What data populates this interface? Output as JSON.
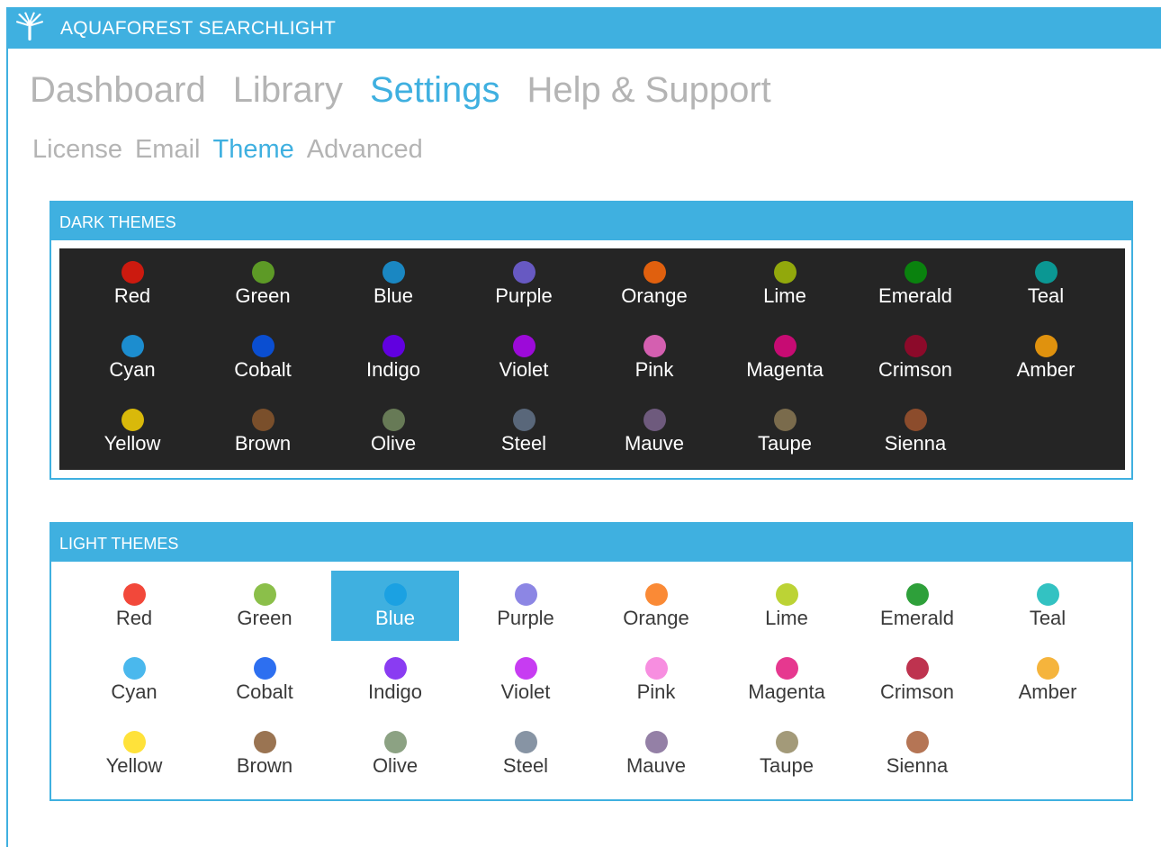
{
  "window": {
    "title": "AQUAFOREST SEARCHLIGHT",
    "icon": "aquaforest-logo-icon"
  },
  "main_nav": [
    {
      "label": "Dashboard",
      "active": false
    },
    {
      "label": "Library",
      "active": false
    },
    {
      "label": "Settings",
      "active": true
    },
    {
      "label": "Help & Support",
      "active": false
    }
  ],
  "sub_nav": [
    {
      "label": "License",
      "active": false
    },
    {
      "label": "Email",
      "active": false
    },
    {
      "label": "Theme",
      "active": true
    },
    {
      "label": "Advanced",
      "active": false
    }
  ],
  "colors": {
    "accent": "#3fb0e0",
    "dark_background": "#252525",
    "inactive_text": "#b4b4b4"
  },
  "dark_themes": {
    "header": "DARK THEMES",
    "items": [
      {
        "name": "Red",
        "color": "#cc1a0f"
      },
      {
        "name": "Green",
        "color": "#5d9a26"
      },
      {
        "name": "Blue",
        "color": "#1a87c2"
      },
      {
        "name": "Purple",
        "color": "#6759c2"
      },
      {
        "name": "Orange",
        "color": "#e0600e"
      },
      {
        "name": "Lime",
        "color": "#92a80c"
      },
      {
        "name": "Emerald",
        "color": "#0a820e"
      },
      {
        "name": "Teal",
        "color": "#0b9793"
      },
      {
        "name": "Cyan",
        "color": "#1c8dcf"
      },
      {
        "name": "Cobalt",
        "color": "#0a4ed1"
      },
      {
        "name": "Indigo",
        "color": "#6100e0"
      },
      {
        "name": "Violet",
        "color": "#9c0ad9"
      },
      {
        "name": "Pink",
        "color": "#d45fb0"
      },
      {
        "name": "Magenta",
        "color": "#c70b73"
      },
      {
        "name": "Crimson",
        "color": "#8c0a2a"
      },
      {
        "name": "Amber",
        "color": "#e0920e"
      },
      {
        "name": "Yellow",
        "color": "#d9b90a"
      },
      {
        "name": "Brown",
        "color": "#7a4f2b"
      },
      {
        "name": "Olive",
        "color": "#677a56"
      },
      {
        "name": "Steel",
        "color": "#59677a"
      },
      {
        "name": "Mauve",
        "color": "#6e5a7d"
      },
      {
        "name": "Taupe",
        "color": "#7a6b4c"
      },
      {
        "name": "Sienna",
        "color": "#8c4c2c"
      }
    ]
  },
  "light_themes": {
    "header": "LIGHT THEMES",
    "selected": "Blue",
    "items": [
      {
        "name": "Red",
        "color": "#f2483a"
      },
      {
        "name": "Green",
        "color": "#8bbf4a"
      },
      {
        "name": "Blue",
        "color": "#1ba1e2"
      },
      {
        "name": "Purple",
        "color": "#8c86e4"
      },
      {
        "name": "Orange",
        "color": "#fa8a36"
      },
      {
        "name": "Lime",
        "color": "#bcd335"
      },
      {
        "name": "Emerald",
        "color": "#2ea03a"
      },
      {
        "name": "Teal",
        "color": "#33c2c2"
      },
      {
        "name": "Cyan",
        "color": "#4ab8ed"
      },
      {
        "name": "Cobalt",
        "color": "#2d6ff0"
      },
      {
        "name": "Indigo",
        "color": "#8a3cf2"
      },
      {
        "name": "Violet",
        "color": "#c73cf2"
      },
      {
        "name": "Pink",
        "color": "#f78ee0"
      },
      {
        "name": "Magenta",
        "color": "#e6388f"
      },
      {
        "name": "Crimson",
        "color": "#be334f"
      },
      {
        "name": "Amber",
        "color": "#f5b43c"
      },
      {
        "name": "Yellow",
        "color": "#ffe23a"
      },
      {
        "name": "Brown",
        "color": "#9a7452"
      },
      {
        "name": "Olive",
        "color": "#8ca283"
      },
      {
        "name": "Steel",
        "color": "#8794a4"
      },
      {
        "name": "Mauve",
        "color": "#9480a6"
      },
      {
        "name": "Taupe",
        "color": "#a39a79"
      },
      {
        "name": "Sienna",
        "color": "#b57555"
      }
    ]
  }
}
